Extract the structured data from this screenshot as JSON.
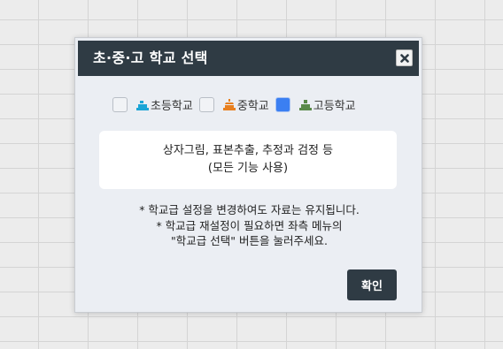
{
  "dialog": {
    "title": "초·중·고 학교 선택",
    "close_icon": "close-icon",
    "options": [
      {
        "label": "초등학교",
        "checked": false,
        "icon": "school-icon",
        "icon_color": "#1aa5d6"
      },
      {
        "label": "중학교",
        "checked": false,
        "icon": "school-icon",
        "icon_color": "#e8801f"
      },
      {
        "label": "고등학교",
        "checked": true,
        "icon": "school-icon",
        "icon_color": "#5a8a4a"
      }
    ],
    "info": {
      "line1": "상자그림, 표본추출, 추정과 검정 등",
      "line2": "(모든 기능 사용)"
    },
    "notes": [
      "* 학교급 설정을 변경하여도 자료는 유지됩니다.",
      "* 학교급 재설정이 필요하면 좌측 메뉴의",
      "\"학교급 선택\" 버튼을 눌러주세요."
    ],
    "confirm_label": "확인"
  },
  "colors": {
    "header_bg": "#2f3b44",
    "checked": "#3b7ff2"
  }
}
